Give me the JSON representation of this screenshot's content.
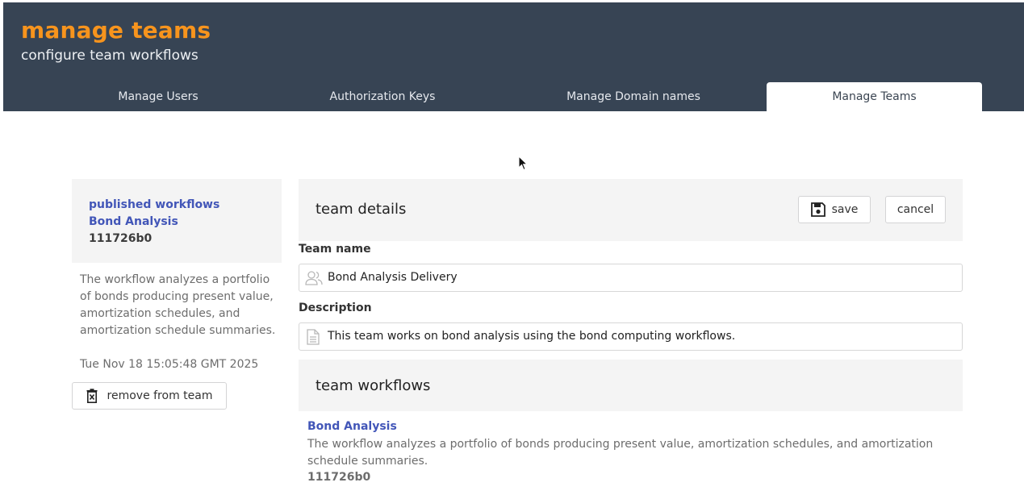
{
  "header": {
    "title": "manage teams",
    "subtitle": "configure team workflows"
  },
  "tabs": [
    {
      "label": "Manage Users",
      "active": false
    },
    {
      "label": "Authorization Keys",
      "active": false
    },
    {
      "label": "Manage Domain names",
      "active": false
    },
    {
      "label": "Manage Teams",
      "active": true
    }
  ],
  "colors": {
    "header_bg": "#374454",
    "title": "#f7941d",
    "link": "#4256b8",
    "panel_bg": "#f4f4f4"
  },
  "sidebar": {
    "heading": "published workflows",
    "workflow_name": "Bond Analysis",
    "workflow_id": "111726b0",
    "description": "The workflow analyzes a portfolio of bonds producing present value, amortization schedules, and amortization schedule summaries.",
    "date": "Tue Nov 18 15:05:48 GMT 2025",
    "remove_label": "remove from team",
    "remove_icon": "trash-x-icon"
  },
  "details": {
    "title": "team details",
    "save_label": "save",
    "save_icon": "floppy-disk-icon",
    "cancel_label": "cancel",
    "team_name_label": "Team name",
    "team_name_value": "Bond Analysis Delivery",
    "team_name_icon": "users-icon",
    "description_label": "Description",
    "description_value": "This team works on bond analysis using the bond computing workflows.",
    "description_icon": "document-icon"
  },
  "team_workflows": {
    "title": "team workflows",
    "items": [
      {
        "name": "Bond Analysis",
        "description": "The workflow analyzes a portfolio of bonds producing present value, amortization schedules, and amortization schedule summaries.",
        "id": "111726b0"
      }
    ]
  }
}
